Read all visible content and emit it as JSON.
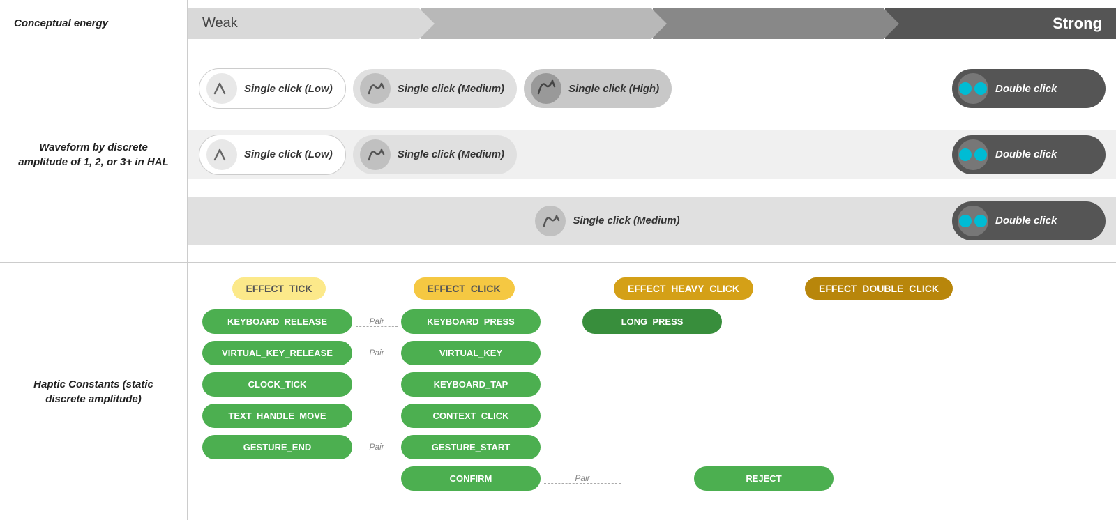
{
  "energy": {
    "weak_label": "Weak",
    "strong_label": "Strong"
  },
  "left_labels": {
    "top": "Conceptual energy",
    "mid": "Waveform by discrete amplitude of 1, 2, or 3+ in HAL",
    "bottom": "Haptic Constants (static discrete amplitude)"
  },
  "waveform_rows": [
    {
      "pills": [
        {
          "type": "white",
          "icon": "wave-low",
          "text": "Single click (Low)"
        },
        {
          "type": "light",
          "icon": "wave-medium",
          "text": "Single click (Medium)"
        },
        {
          "type": "mid",
          "icon": "wave-high",
          "text": "Single click (High)"
        }
      ],
      "dark_pill": {
        "icon": "double",
        "text": "Double click"
      }
    },
    {
      "pills": [
        {
          "type": "white",
          "icon": "wave-low",
          "text": "Single click (Low)"
        },
        {
          "type": "light",
          "icon": "wave-medium",
          "text": "Single click (Medium)"
        }
      ],
      "dark_pill": {
        "icon": "double",
        "text": "Double click"
      }
    },
    {
      "pills": [
        {
          "type": "mid",
          "icon": "wave-medium",
          "text": "Single click (Medium)"
        }
      ],
      "dark_pill": {
        "icon": "double",
        "text": "Double click"
      }
    }
  ],
  "effects": [
    {
      "label": "EFFECT_TICK",
      "style": "light"
    },
    {
      "label": "EFFECT_CLICK",
      "style": "medium"
    },
    {
      "label": "EFFECT_HEAVY_CLICK",
      "style": "dark-yellow"
    },
    {
      "label": "EFFECT_DOUBLE_CLICK",
      "style": "darkest"
    }
  ],
  "haptic_constants": {
    "col1": [
      {
        "label": "KEYBOARD_RELEASE",
        "pair": true
      },
      {
        "label": "VIRTUAL_KEY_RELEASE",
        "pair": true
      },
      {
        "label": "CLOCK_TICK"
      },
      {
        "label": "TEXT_HANDLE_MOVE"
      },
      {
        "label": "GESTURE_END",
        "pair": true
      }
    ],
    "col2": [
      {
        "label": "KEYBOARD_PRESS"
      },
      {
        "label": "VIRTUAL_KEY"
      },
      {
        "label": "KEYBOARD_TAP"
      },
      {
        "label": "CONTEXT_CLICK"
      },
      {
        "label": "GESTURE_START"
      },
      {
        "label": "CONFIRM",
        "pair_right": true
      }
    ],
    "col3": [
      {
        "label": "LONG_PRESS"
      }
    ],
    "col4": [
      {
        "label": "REJECT"
      }
    ]
  }
}
